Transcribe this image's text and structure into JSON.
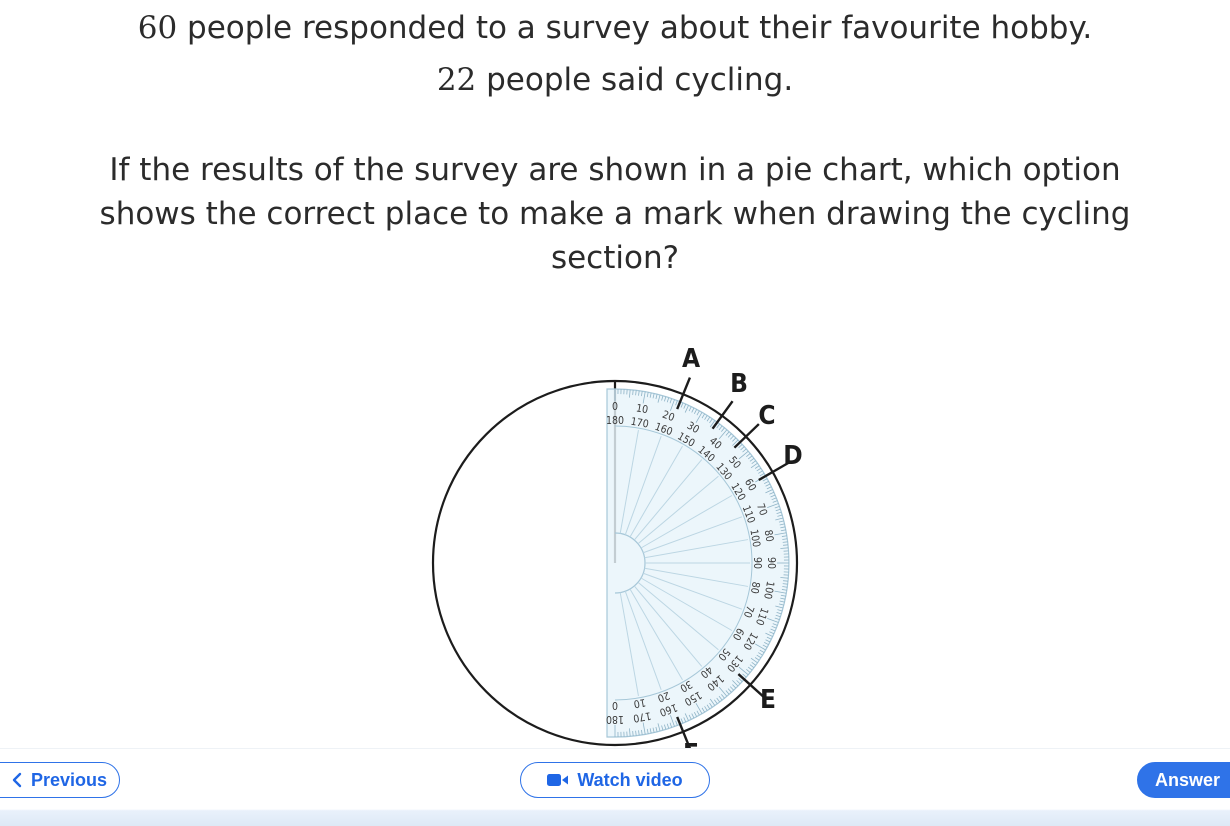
{
  "question": {
    "line1_num": "60",
    "line1_text": " people responded to a survey about their favourite hobby.",
    "line2_num": "22",
    "line2_text": " people said cycling.",
    "line3": "If the results of the survey are shown in a pie chart, which option",
    "line4": "shows the correct place to make a mark when drawing the cycling",
    "line5": "section?"
  },
  "figure": {
    "labels": {
      "a": "A",
      "b": "B",
      "c": "C",
      "d": "D",
      "e": "E",
      "f": "F"
    },
    "outer_scale": [
      "0",
      "10",
      "20",
      "30",
      "40",
      "50",
      "60",
      "70",
      "80",
      "90",
      "100",
      "110",
      "120",
      "130",
      "140",
      "150",
      "160",
      "170",
      "180"
    ],
    "inner_scale": [
      "180",
      "170",
      "160",
      "150",
      "140",
      "130",
      "120",
      "110",
      "100",
      "90",
      "80",
      "70",
      "60",
      "50",
      "40",
      "30",
      "20",
      "10",
      "0"
    ]
  },
  "footer": {
    "previous_label": "Previous",
    "watch_label": "Watch video",
    "answer_label": "Answer",
    "accent_color": "#2f73e8"
  }
}
